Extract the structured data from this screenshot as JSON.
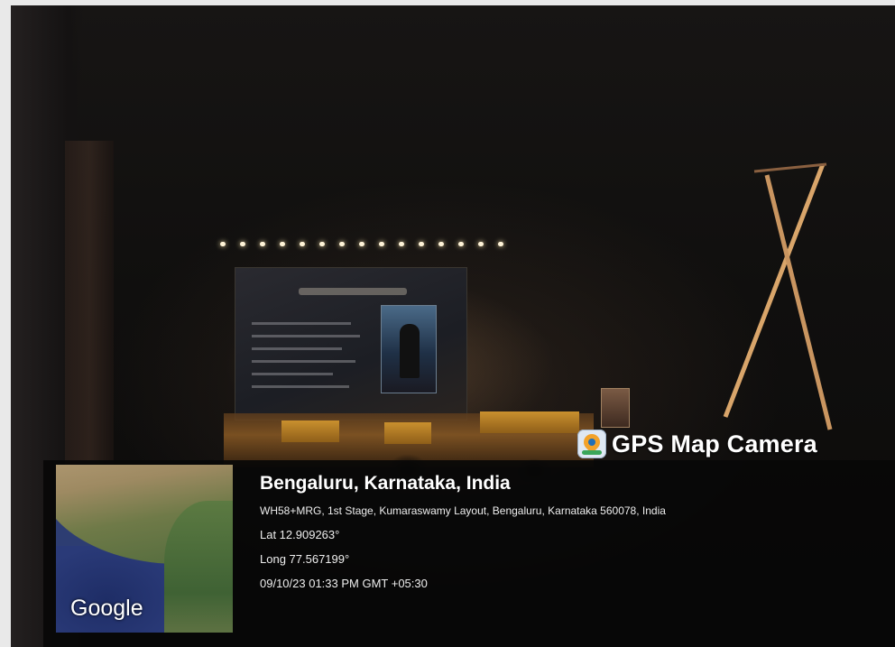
{
  "watermark": {
    "brand": "GPS Map Camera",
    "icon": "gps-map-camera-app-icon"
  },
  "location": {
    "title": "Bengaluru, Karnataka, India",
    "address": "WH58+MRG, 1st Stage, Kumaraswamy Layout, Bengaluru, Karnataka 560078, India",
    "latitude": "Lat 12.909263°",
    "longitude": "Long 77.567199°",
    "datetime": "09/10/23 01:33 PM GMT +05:30"
  },
  "map": {
    "provider_logo": "Google"
  },
  "colors": {
    "watermark_text": "#ffffff",
    "panel_background": "#080808",
    "stage_gold": "#c9902e"
  }
}
